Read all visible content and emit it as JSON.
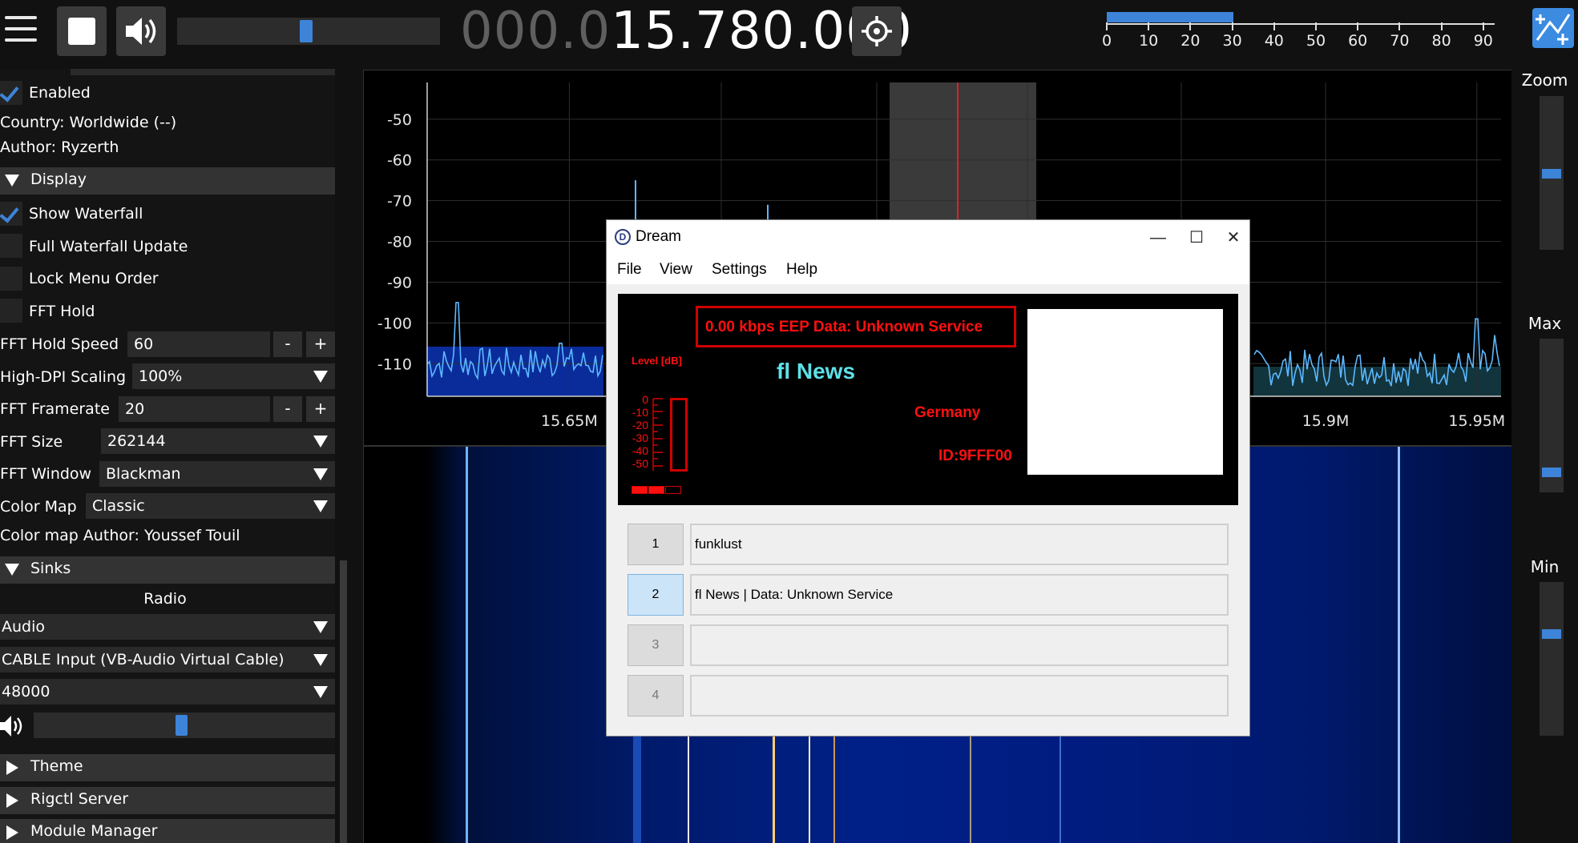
{
  "topbar": {
    "menu_icon": "hamburger-icon",
    "stop_icon": "stop-icon",
    "volume_icon": "speaker-icon",
    "volume_level": 0.5,
    "frequency_dim": "000.0",
    "frequency_bright": "15.780.000",
    "tune_icon": "crosshair-icon",
    "snr_level": 30,
    "snr_scale": [
      "0",
      "10",
      "20",
      "30",
      "40",
      "50",
      "60",
      "70",
      "80",
      "90"
    ],
    "app_icon": "add-window-icon"
  },
  "panel": {
    "enabled_label": "Enabled",
    "country": "Country: Worldwide (--)",
    "author": "Author: Ryzerth",
    "display_section": "Display",
    "show_waterfall": "Show Waterfall",
    "full_waterfall": "Full Waterfall Update",
    "lock_menu": "Lock Menu Order",
    "fft_hold": "FFT Hold",
    "fft_hold_speed_label": "FFT Hold Speed",
    "fft_hold_speed_value": "60",
    "high_dpi_label": "High-DPI Scaling",
    "high_dpi_value": "100%",
    "fft_framerate_label": "FFT Framerate",
    "fft_framerate_value": "20",
    "fft_size_label": "FFT Size",
    "fft_size_value": "262144",
    "fft_window_label": "FFT Window",
    "fft_window_value": "Blackman",
    "color_map_label": "Color Map",
    "color_map_value": "Classic",
    "color_map_author": "Color map Author: Youssef Touil",
    "sinks_section": "Sinks",
    "radio_label": "Radio",
    "sink_type": "Audio",
    "sink_device": "CABLE Input (VB-Audio Virtual Cable)",
    "sink_rate": "48000",
    "sink_volume": 0.5,
    "theme_section": "Theme",
    "rigctl_section": "Rigctl Server",
    "module_section": "Module Manager",
    "minus": "-",
    "plus": "+"
  },
  "right": {
    "zoom_label": "Zoom",
    "max_label": "Max",
    "min_label": "Min"
  },
  "dream": {
    "title": "Dream",
    "logo": "D",
    "minimize": "—",
    "maximize": "☐",
    "close": "✕",
    "menu": [
      "File",
      "View",
      "Settings",
      "Help"
    ],
    "status": "0.00 kbps EEP  Data:  Unknown Service",
    "service_name": "fl News",
    "country": "Germany",
    "id": "ID:9FFF00",
    "level_title": "Level [dB]",
    "level_scale": [
      "0",
      "-10",
      "-20",
      "-30",
      "-40",
      "-50"
    ],
    "services": [
      {
        "num": "1",
        "label": "funklust"
      },
      {
        "num": "2",
        "label": "fl News  |    Data: Unknown Service"
      },
      {
        "num": "3",
        "label": ""
      },
      {
        "num": "4",
        "label": ""
      }
    ]
  },
  "chart_data": {
    "type": "line",
    "y_ticks": [
      "-50",
      "-60",
      "-70",
      "-80",
      "-90",
      "-100",
      "-110"
    ],
    "x_ticks": [
      "15.65M",
      "15.9M",
      "15.95M"
    ],
    "ylim": [
      -118,
      -41
    ],
    "xlim": [
      15.603,
      15.958
    ]
  }
}
